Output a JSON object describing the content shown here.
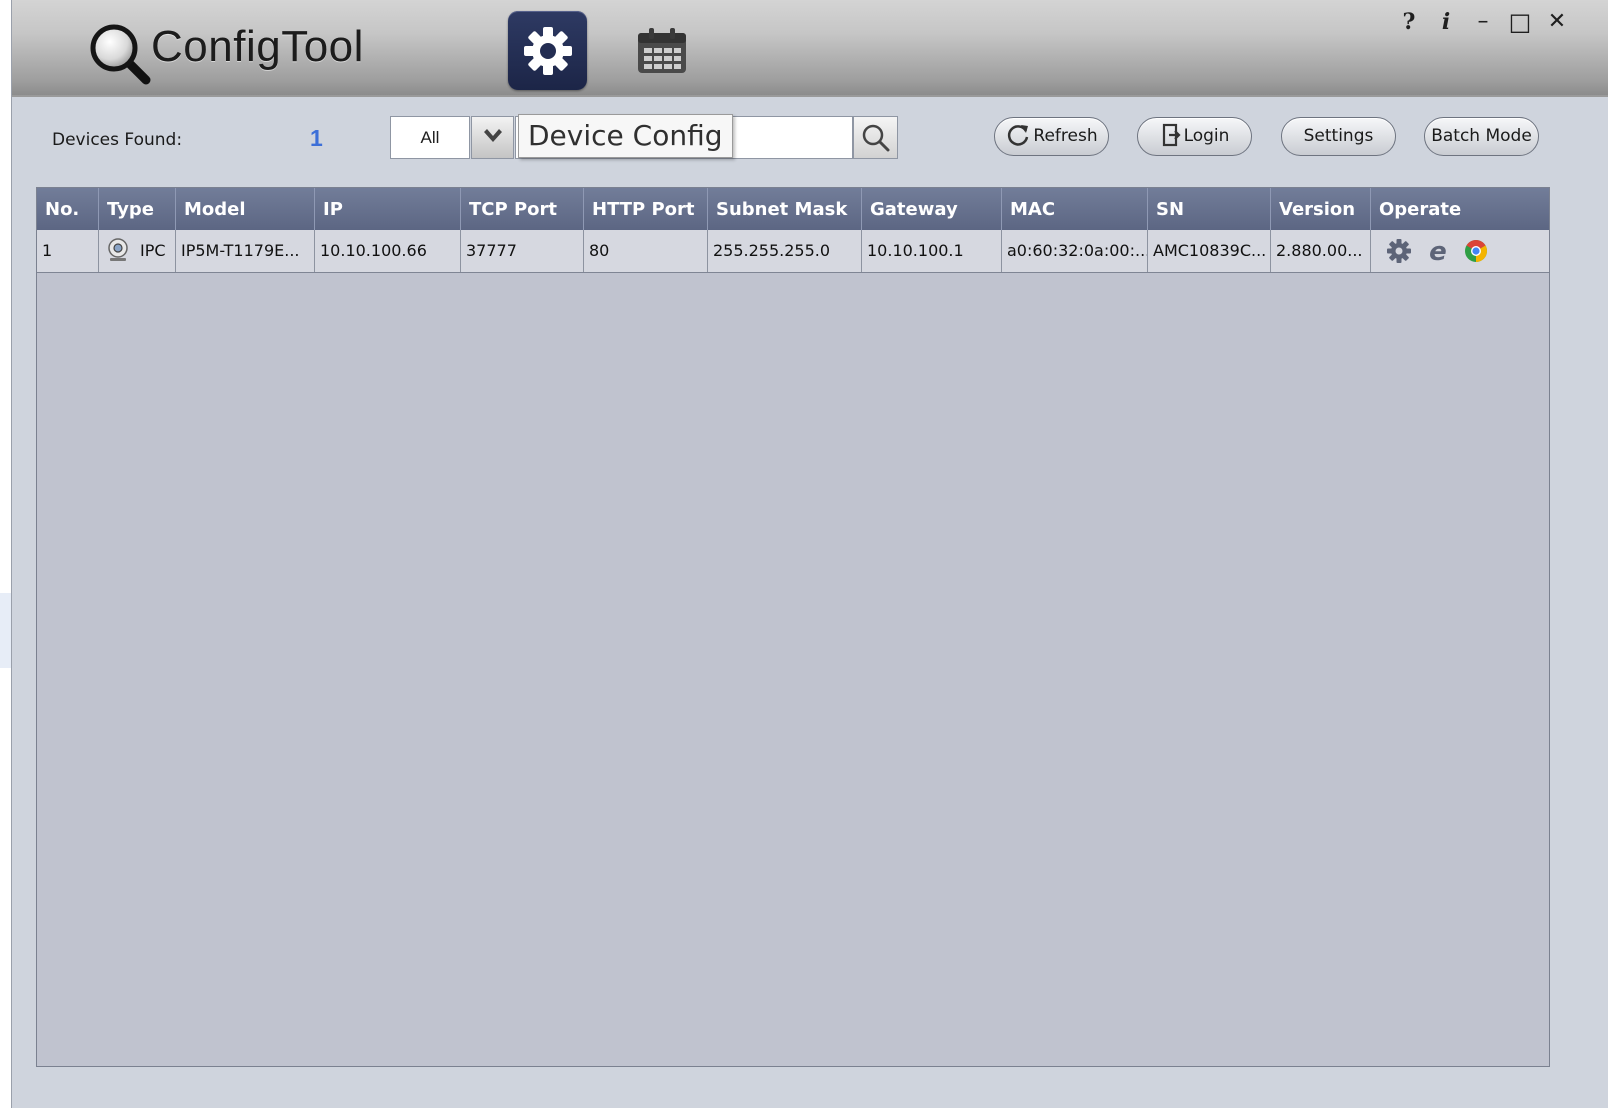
{
  "app": {
    "title": "ConfigTool"
  },
  "apps": [
    {
      "name": "Device Config",
      "icon": "gear-icon"
    },
    {
      "name": "Calendar",
      "icon": "calendar-icon"
    }
  ],
  "window_controls": {
    "help": "?",
    "info": "i",
    "minimize": "–",
    "maximize": "□",
    "close": "✕"
  },
  "toolbar": {
    "devices_found_label": "Devices Found:",
    "devices_found_count": "1",
    "filter_value": "All",
    "search_value": "",
    "tooltip": "Device Config",
    "refresh_label": "Refresh",
    "login_label": "Login",
    "settings_label": "Settings",
    "batch_mode_label": "Batch Mode"
  },
  "table": {
    "columns": [
      "No.",
      "Type",
      "Model",
      "IP",
      "TCP Port",
      "HTTP Port",
      "Subnet Mask",
      "Gateway",
      "MAC",
      "SN",
      "Version",
      "Operate"
    ],
    "rows": [
      {
        "no": "1",
        "type": "IPC",
        "model": "IP5M-T1179E...",
        "ip": "10.10.100.66",
        "tcp_port": "37777",
        "http_port": "80",
        "subnet_mask": "255.255.255.0",
        "gateway": "10.10.100.1",
        "mac": "a0:60:32:0a:00:...",
        "sn": "AMC10839C...",
        "version": "2.880.00...",
        "operate": [
          "gear-icon",
          "ie-icon",
          "chrome-icon"
        ]
      }
    ]
  },
  "colors": {
    "accent_count": "#3d6fd8",
    "header_bg": "#66708c",
    "table_bg": "#c0c3cf",
    "config_button": "#1c2547"
  }
}
